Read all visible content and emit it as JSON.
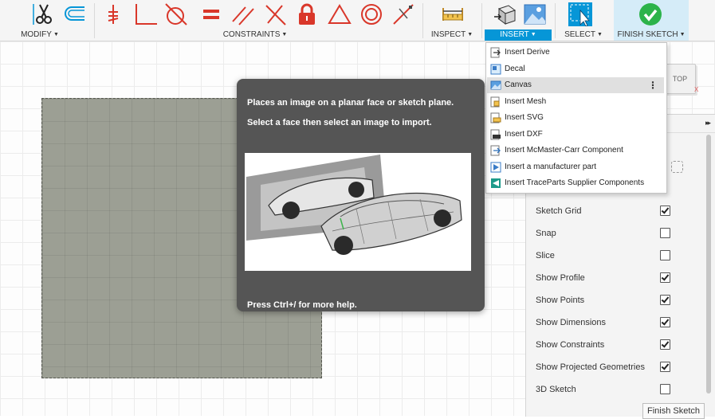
{
  "toolbar": {
    "groups": {
      "modify": "MODIFY",
      "constraints": "CONSTRAINTS",
      "inspect": "INSPECT",
      "insert": "INSERT",
      "select": "SELECT",
      "finish_sketch": "FINISH SKETCH"
    },
    "icons": {
      "modify": [
        "trim-scissors-icon",
        "offset-icon"
      ],
      "constraints": [
        "coincident-icon",
        "horizontal-vertical-icon",
        "tangent-icon",
        "equal-icon",
        "parallel-icon",
        "perpendicular-icon",
        "fix-lock-icon",
        "concentric-triangle-icon",
        "concentric-circles-icon",
        "midpoint-icon"
      ],
      "inspect": [
        "measure-icon"
      ],
      "insert": [
        "insert-derive-icon",
        "insert-canvas-image-icon"
      ],
      "select": [
        "select-arrow-icon"
      ],
      "finish": [
        "finish-check-icon"
      ]
    },
    "accent_color": "#0696d7",
    "finish_color": "#2cb34a",
    "constraint_color": "#d9372a"
  },
  "insert_menu": {
    "items": [
      {
        "label": "Insert Derive",
        "icon": "insert-derive-icon"
      },
      {
        "label": "Decal",
        "icon": "decal-icon"
      },
      {
        "label": "Canvas",
        "icon": "canvas-icon",
        "highlighted": true
      },
      {
        "label": "Insert Mesh",
        "icon": "insert-mesh-icon"
      },
      {
        "label": "Insert SVG",
        "icon": "insert-svg-icon"
      },
      {
        "label": "Insert DXF",
        "icon": "insert-dxf-icon"
      },
      {
        "label": "Insert McMaster-Carr Component",
        "icon": "mcmaster-carr-icon"
      },
      {
        "label": "Insert a manufacturer part",
        "icon": "manufacturer-part-icon"
      },
      {
        "label": "Insert TraceParts Supplier Components",
        "icon": "traceparts-icon"
      }
    ],
    "more_glyph": "⋮"
  },
  "tooltip": {
    "line1": "Places an image on a planar face or sketch plane.",
    "line2": "Select a face then select an image to import.",
    "footer": "Press Ctrl+/ for more help."
  },
  "viewcube": {
    "face": "TOP",
    "axis": "X"
  },
  "palette": {
    "collapse_glyph": "▸▸",
    "options": [
      {
        "label": "Sketch Grid",
        "checked": true
      },
      {
        "label": "Snap",
        "checked": false
      },
      {
        "label": "Slice",
        "checked": false
      },
      {
        "label": "Show Profile",
        "checked": true
      },
      {
        "label": "Show Points",
        "checked": true
      },
      {
        "label": "Show Dimensions",
        "checked": true
      },
      {
        "label": "Show Constraints",
        "checked": true
      },
      {
        "label": "Show Projected Geometries",
        "checked": true
      },
      {
        "label": "3D Sketch",
        "checked": false
      }
    ],
    "finish_button": "Finish Sketch"
  }
}
